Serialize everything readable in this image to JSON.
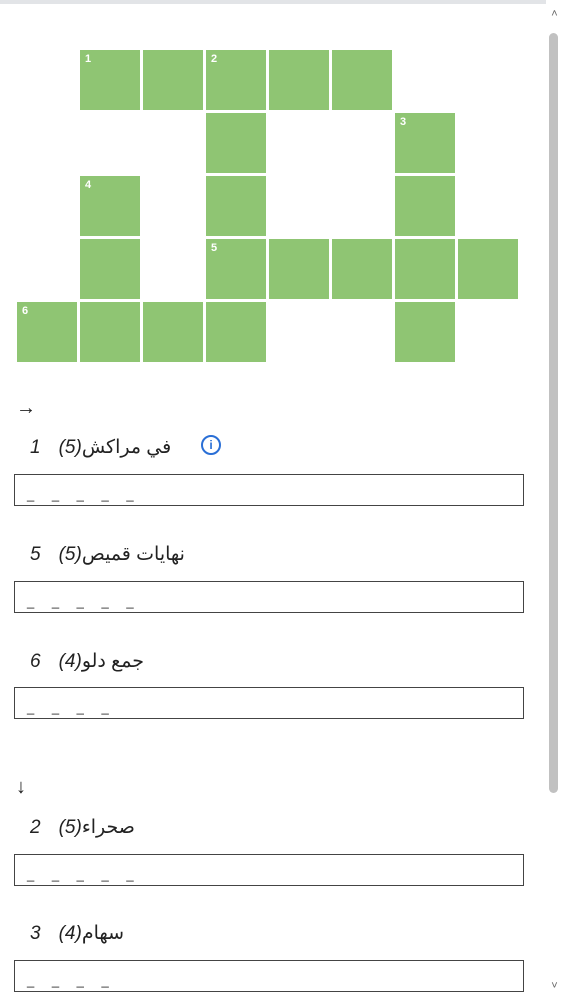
{
  "grid": {
    "cells": [
      {
        "row": 0,
        "col": 1,
        "num": "1"
      },
      {
        "row": 0,
        "col": 2,
        "num": ""
      },
      {
        "row": 0,
        "col": 3,
        "num": "2"
      },
      {
        "row": 0,
        "col": 4,
        "num": ""
      },
      {
        "row": 0,
        "col": 5,
        "num": ""
      },
      {
        "row": 1,
        "col": 3,
        "num": ""
      },
      {
        "row": 1,
        "col": 6,
        "num": "3"
      },
      {
        "row": 2,
        "col": 1,
        "num": "4"
      },
      {
        "row": 2,
        "col": 3,
        "num": ""
      },
      {
        "row": 2,
        "col": 6,
        "num": ""
      },
      {
        "row": 3,
        "col": 1,
        "num": ""
      },
      {
        "row": 3,
        "col": 3,
        "num": "5"
      },
      {
        "row": 3,
        "col": 4,
        "num": ""
      },
      {
        "row": 3,
        "col": 5,
        "num": ""
      },
      {
        "row": 3,
        "col": 6,
        "num": ""
      },
      {
        "row": 3,
        "col": 7,
        "num": ""
      },
      {
        "row": 4,
        "col": 0,
        "num": "6"
      },
      {
        "row": 4,
        "col": 1,
        "num": ""
      },
      {
        "row": 4,
        "col": 2,
        "num": ""
      },
      {
        "row": 4,
        "col": 3,
        "num": ""
      },
      {
        "row": 4,
        "col": 6,
        "num": ""
      }
    ]
  },
  "across": {
    "arrow": "→",
    "clues": [
      {
        "num": "1",
        "text": "في مراكش",
        "len": "(5)",
        "blanks": "_ _ _ _ _",
        "info": "i"
      },
      {
        "num": "5",
        "text": "نهايات قميص",
        "len": "(5)",
        "blanks": "_ _ _ _ _"
      },
      {
        "num": "6",
        "text": "جمع دلو",
        "len": "(4)",
        "blanks": "_ _ _ _"
      }
    ]
  },
  "down": {
    "arrow": "↓",
    "clues": [
      {
        "num": "2",
        "text": "صحراء",
        "len": "(5)",
        "blanks": "_ _ _ _ _"
      },
      {
        "num": "3",
        "text": "سهام",
        "len": "(4)",
        "blanks": "_ _ _ _"
      }
    ]
  },
  "scrollbar": {
    "up": "˄",
    "down": "˅"
  }
}
